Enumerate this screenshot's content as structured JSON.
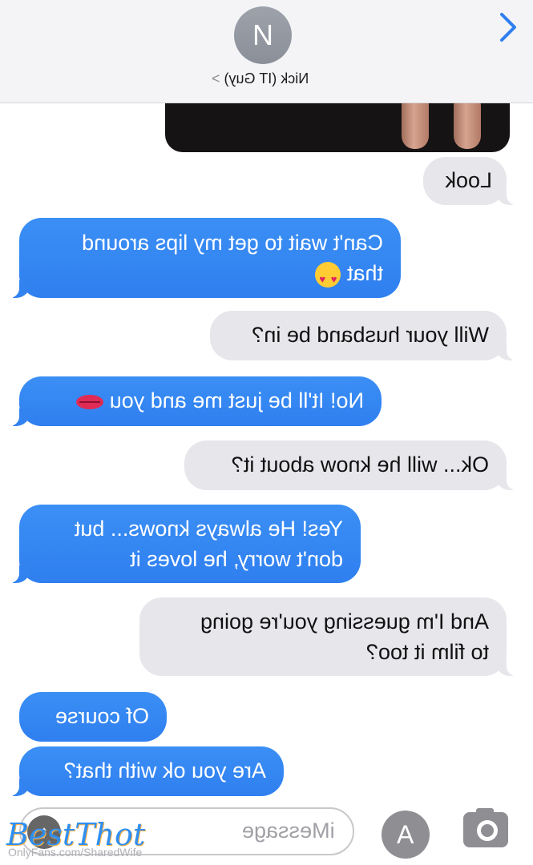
{
  "header": {
    "avatar_initial": "N",
    "contact_name": "Nick (IT Guy)",
    "contact_chevron": ">"
  },
  "messages": [
    {
      "side": "gray",
      "text": "Look"
    },
    {
      "side": "blue",
      "line1": "Can't wait to get my lips around",
      "line2": "that"
    },
    {
      "side": "gray",
      "text": "Will your husband be in?"
    },
    {
      "side": "blue",
      "text": "No! It'll be just me and you"
    },
    {
      "side": "gray",
      "text": "Ok... will he know about it?"
    },
    {
      "side": "blue",
      "line1": "Yes! He always knows... but",
      "line2": "don't worry, he loves it"
    },
    {
      "side": "gray",
      "line1": "And I'm guessing you're going",
      "line2": "to film it too?"
    },
    {
      "side": "blue",
      "text": "Of course"
    },
    {
      "side": "blue",
      "text": "Are you ok with that?"
    }
  ],
  "composer": {
    "placeholder": "iMessage",
    "store_icon": "A"
  },
  "watermark": {
    "brand": "BestThot",
    "source": "OnlyFans.com/SharedWife"
  },
  "icons": [
    "camera-icon",
    "app-store-icon",
    "send-arrow-icon",
    "back-chevron-icon"
  ]
}
